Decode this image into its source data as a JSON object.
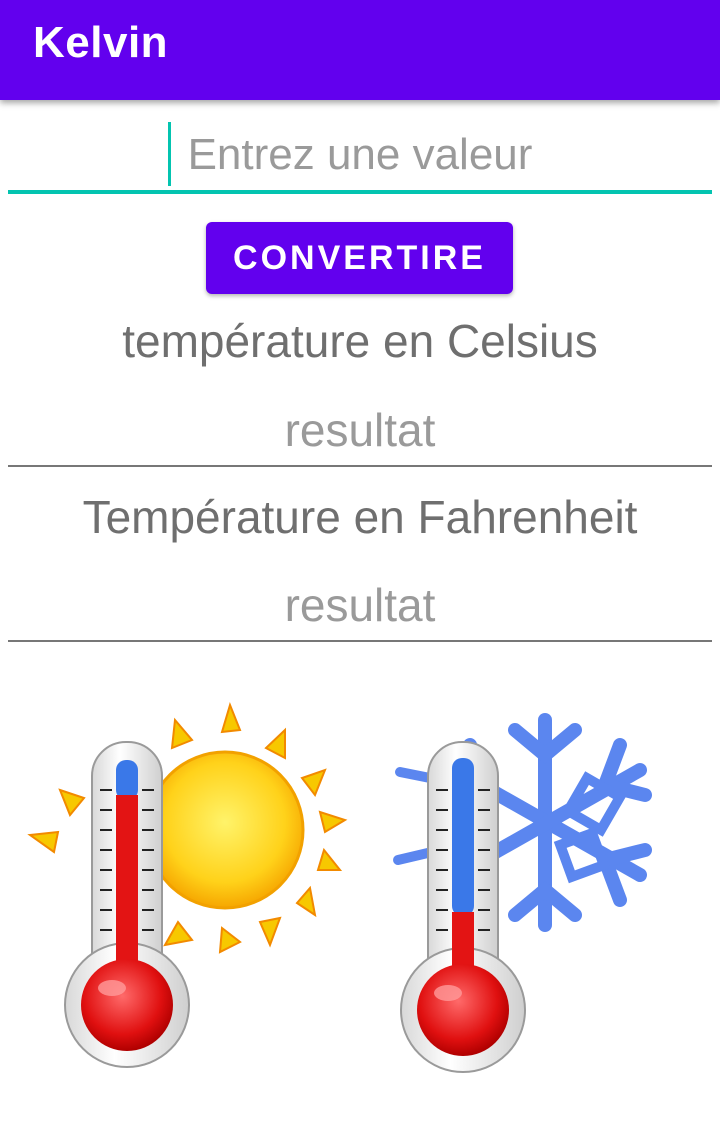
{
  "app": {
    "title": "Kelvin"
  },
  "input": {
    "placeholder": "Entrez une valeur",
    "value": ""
  },
  "convert_button": {
    "label": "CONVERTIRE"
  },
  "celsius": {
    "label": "température en Celsius",
    "result": "resultat"
  },
  "fahrenheit": {
    "label": "Température en Fahrenheit",
    "result": "resultat"
  },
  "colors": {
    "primary": "#6200ee",
    "accent": "#03c4b0"
  },
  "illustration": {
    "icons": [
      "thermometer-hot-icon",
      "sun-icon",
      "thermometer-cold-icon",
      "snowflake-icon"
    ]
  }
}
